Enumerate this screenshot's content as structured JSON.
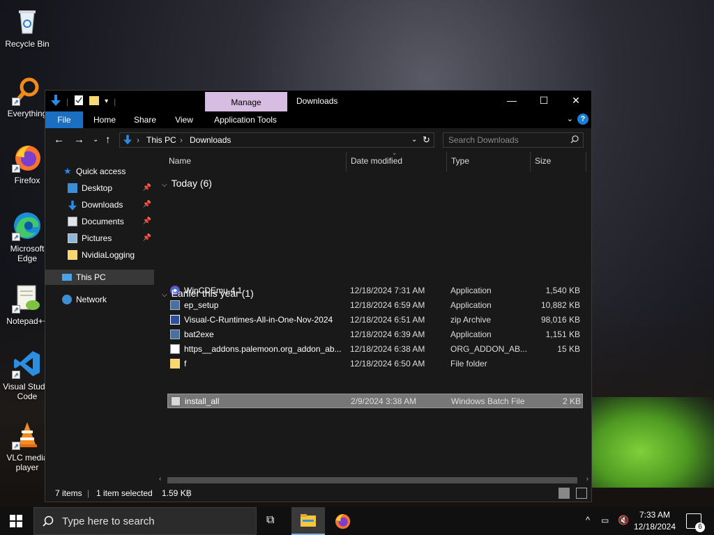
{
  "desktop": {
    "icons": [
      {
        "label": "Recycle Bin"
      },
      {
        "label": "Everything"
      },
      {
        "label": "Firefox"
      },
      {
        "label": "Microsoft Edge"
      },
      {
        "label": "Notepad++"
      },
      {
        "label": "Visual Studio Code"
      },
      {
        "label": "VLC media player"
      }
    ]
  },
  "window": {
    "title": "Downloads",
    "contextual_tab": "Manage",
    "ribbon_tabs": [
      "File",
      "Home",
      "Share",
      "View",
      "Application Tools"
    ],
    "help": "?",
    "breadcrumb": [
      "This PC",
      "Downloads"
    ],
    "search_placeholder": "Search Downloads",
    "columns": [
      "Name",
      "Date modified",
      "Type",
      "Size"
    ],
    "nav": {
      "quick_access": "Quick access",
      "items": [
        "Desktop",
        "Downloads",
        "Documents",
        "Pictures",
        "NvidiaLogging"
      ],
      "this_pc": "This PC",
      "network": "Network"
    },
    "groups": [
      {
        "label": "Today (6)",
        "files": [
          {
            "name": "WinCDEmu-4.1",
            "date": "12/18/2024 7:31 AM",
            "type": "Application",
            "size": "1,540 KB",
            "icon": "app-disc-icon"
          },
          {
            "name": "ep_setup",
            "date": "12/18/2024 6:59 AM",
            "type": "Application",
            "size": "10,882 KB",
            "icon": "app-icon"
          },
          {
            "name": "Visual-C-Runtimes-All-in-One-Nov-2024",
            "date": "12/18/2024 6:51 AM",
            "type": "zip Archive",
            "size": "98,016 KB",
            "icon": "zip-icon"
          },
          {
            "name": "bat2exe",
            "date": "12/18/2024 6:39 AM",
            "type": "Application",
            "size": "1,151 KB",
            "icon": "app-icon"
          },
          {
            "name": "https__addons.palemoon.org_addon_ab...",
            "date": "12/18/2024 6:38 AM",
            "type": "ORG_ADDON_AB...",
            "size": "15 KB",
            "icon": "document-icon"
          },
          {
            "name": "f",
            "date": "12/18/2024 6:50 AM",
            "type": "File folder",
            "size": "",
            "icon": "folder-icon"
          }
        ]
      },
      {
        "label": "Earlier this year (1)",
        "files": [
          {
            "name": "install_all",
            "date": "2/9/2024 3:38 AM",
            "type": "Windows Batch File",
            "size": "2 KB",
            "icon": "batch-file-icon",
            "selected": true
          }
        ]
      }
    ],
    "status": {
      "items": "7 items",
      "selected": "1 item selected",
      "size": "1.59 KB"
    }
  },
  "taskbar": {
    "search_placeholder": "Type here to search",
    "time": "7:33 AM",
    "date": "12/18/2024",
    "notifications": "6"
  },
  "colors": {
    "accent": "#1a6fc2",
    "manage_tab": "#d7bde2",
    "window_bg": "#191919",
    "selection": "#777777"
  }
}
